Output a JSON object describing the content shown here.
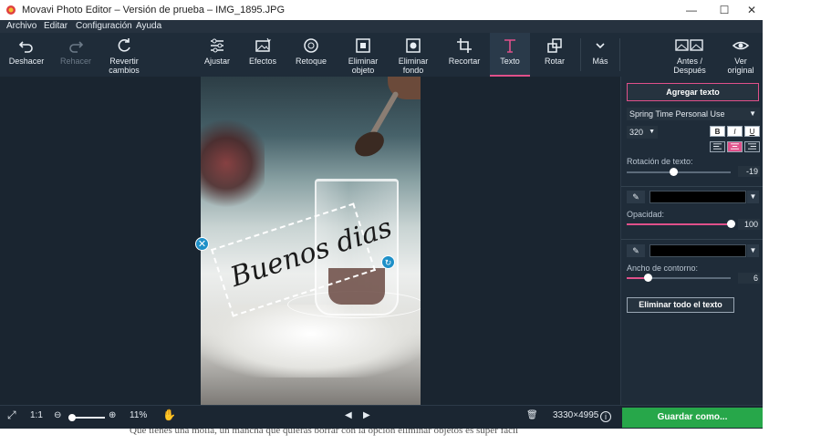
{
  "window": {
    "title": "Movavi Photo Editor – Versión de prueba – IMG_1895.JPG",
    "controls": [
      "minimize-icon",
      "maximize-icon",
      "close-icon"
    ]
  },
  "menu": {
    "items": [
      "Archivo",
      "Editar",
      "Configuración",
      "Ayuda"
    ]
  },
  "toolbar": {
    "undo_label": "Deshacer",
    "redo_label": "Rehacer",
    "revert_label_1": "Revertir",
    "revert_label_2": "cambios",
    "tools": [
      {
        "label": "Ajustar",
        "icon": "sliders-icon"
      },
      {
        "label": "Efectos",
        "icon": "effects-icon"
      },
      {
        "label": "Retoque",
        "icon": "retouch-icon"
      },
      {
        "label_1": "Eliminar",
        "label_2": "objeto",
        "icon": "eraser-icon"
      },
      {
        "label_1": "Eliminar",
        "label_2": "fondo",
        "icon": "background-icon"
      },
      {
        "label": "Recortar",
        "icon": "crop-icon"
      },
      {
        "label": "Texto",
        "icon": "text-icon",
        "active": true
      },
      {
        "label": "Rotar",
        "icon": "rotate-icon"
      },
      {
        "label": "Más",
        "icon": "chevron-down-icon"
      }
    ],
    "before_after_1": "Antes /",
    "before_after_2": "Después",
    "view_original_1": "Ver",
    "view_original_2": "original"
  },
  "canvas": {
    "overlay_text": "Buenos dias"
  },
  "panel": {
    "add_text_label": "Agregar texto",
    "font_name": "Spring Time Personal Use",
    "font_size": "320",
    "format_buttons": [
      "B",
      "I",
      "U"
    ],
    "rotation_label": "Rotación de texto:",
    "rotation_value": "-19",
    "rotation_fraction": 0.45,
    "text_color": "#000000",
    "opacity_label": "Opacidad:",
    "opacity_value": "100",
    "opacity_fraction": 1.0,
    "outline_color": "#000000",
    "outline_label": "Ancho de contorno:",
    "outline_value": "6",
    "outline_fraction": 0.2,
    "clear_all_label": "Eliminar todo el texto"
  },
  "bottombar": {
    "zoom_ratio_label": "1:1",
    "zoom_value": "11%",
    "image_size": "3330×4995",
    "save_label": "Guardar como..."
  },
  "below_text": "Que tienes una molia, un mancha que quieras borrar con la opción eliminar objetos es súper fácil",
  "colors": {
    "accent": "#e0508a",
    "save": "#27a74a",
    "background": "#1e2a36"
  }
}
